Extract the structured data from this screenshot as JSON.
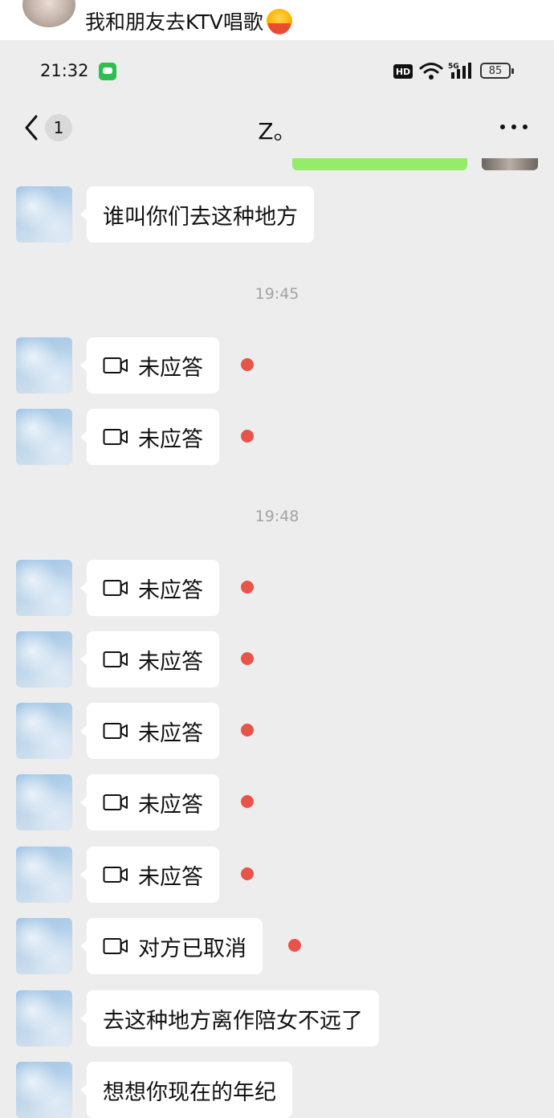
{
  "post": {
    "caption": "我和朋友去KTV唱歌"
  },
  "status_bar": {
    "time": "21:32",
    "hd": "HD",
    "network": "5G",
    "battery": "85"
  },
  "nav": {
    "unread_count": "1",
    "title": "Z。"
  },
  "timestamps": [
    "19:45",
    "19:48"
  ],
  "messages": [
    {
      "type": "text",
      "text": "谁叫你们去这种地方"
    },
    {
      "type": "video_call",
      "text": "未应答"
    },
    {
      "type": "video_call",
      "text": "未应答"
    },
    {
      "type": "video_call",
      "text": "未应答"
    },
    {
      "type": "video_call",
      "text": "未应答"
    },
    {
      "type": "video_call",
      "text": "未应答"
    },
    {
      "type": "video_call",
      "text": "未应答"
    },
    {
      "type": "video_call",
      "text": "未应答"
    },
    {
      "type": "video_call",
      "text": "对方已取消"
    },
    {
      "type": "text",
      "text": "去这种地方离作陪女不远了"
    },
    {
      "type": "text",
      "text": "想想你现在的年纪"
    }
  ],
  "colors": {
    "bg": "#ededed",
    "my_bubble": "#95ec69",
    "their_bubble": "#ffffff",
    "unread_dot": "#e8534a"
  }
}
